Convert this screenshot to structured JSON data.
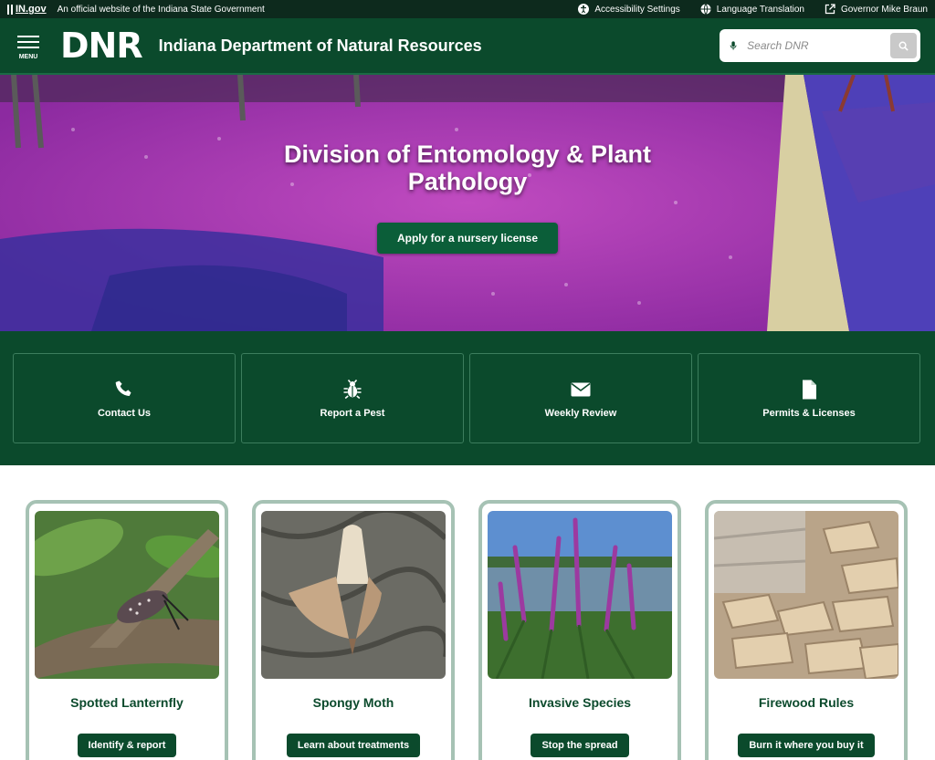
{
  "util": {
    "ingov": "IN.gov",
    "official": "An official website of the Indiana State Government",
    "links": [
      {
        "label": "Accessibility Settings",
        "icon": "accessibility-icon"
      },
      {
        "label": "Language Translation",
        "icon": "globe-icon"
      },
      {
        "label": "Governor Mike Braun",
        "icon": "external-link-icon"
      }
    ]
  },
  "header": {
    "menu_label": "MENU",
    "logo": "DNR",
    "agency": "Indiana Department of Natural Resources",
    "search_placeholder": "Search DNR"
  },
  "hero": {
    "title": "Division of Entomology & Plant Pathology",
    "button": "Apply for a nursery license"
  },
  "quick_links": [
    {
      "label": "Contact Us",
      "icon": "phone-icon"
    },
    {
      "label": "Report a Pest",
      "icon": "bug-icon"
    },
    {
      "label": "Weekly Review",
      "icon": "envelope-icon"
    },
    {
      "label": "Permits & Licenses",
      "icon": "document-icon"
    }
  ],
  "topics": [
    {
      "title": "Spotted Lanternfly",
      "button": "Identify & report"
    },
    {
      "title": "Spongy Moth",
      "button": "Learn about treatments"
    },
    {
      "title": "Invasive Species",
      "button": "Stop the spread"
    },
    {
      "title": "Firewood Rules",
      "button": "Burn it where you buy it"
    }
  ],
  "colors": {
    "primary_green": "#0b4a2c",
    "button_green": "#0b5e39",
    "card_border": "#a6c2b4"
  }
}
